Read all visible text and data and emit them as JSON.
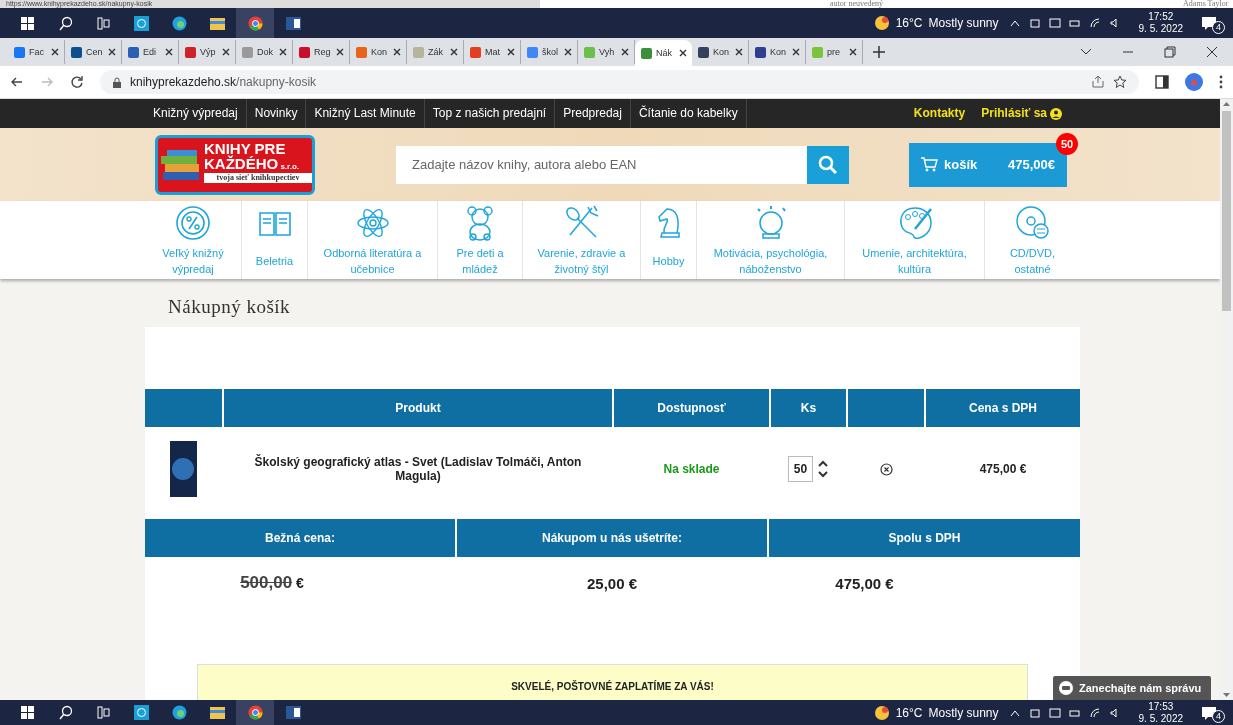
{
  "background_strip": {
    "url": "https://www.knihyprekazdeho.sk/nakupny-kosik",
    "texts": [
      "autor neuvedený",
      "Adams Taylor"
    ]
  },
  "taskbar_top": {
    "temperature": "16°C",
    "weather": "Mostly sunny",
    "time": "17:52",
    "date": "9. 5. 2022",
    "notifications": "4"
  },
  "tabs": [
    {
      "label": "Fac",
      "selected": false,
      "color": "#1877f2"
    },
    {
      "label": "Cen",
      "selected": false,
      "color": "#0b4f8c"
    },
    {
      "label": "Edi",
      "selected": false,
      "color": "#2b5fb4"
    },
    {
      "label": "Výp",
      "selected": false,
      "color": "#d0202a"
    },
    {
      "label": "Dok",
      "selected": false,
      "color": "#9a9a9a"
    },
    {
      "label": "Reg",
      "selected": false,
      "color": "#c8102e"
    },
    {
      "label": "Kon",
      "selected": false,
      "color": "#e8641b"
    },
    {
      "label": "Zák",
      "selected": false,
      "color": "#b8b49a"
    },
    {
      "label": "Mat",
      "selected": false,
      "color": "#e04020"
    },
    {
      "label": "škol",
      "selected": false,
      "color": "#4285f4"
    },
    {
      "label": "Vyh",
      "selected": false,
      "color": "#6cc04a"
    },
    {
      "label": "Nák",
      "selected": true,
      "color": "#3a8f3a"
    },
    {
      "label": "Kon",
      "selected": false,
      "color": "#33415c"
    },
    {
      "label": "Kon",
      "selected": false,
      "color": "#2f3f8f"
    },
    {
      "label": "pre",
      "selected": false,
      "color": "#7cc43a"
    }
  ],
  "address_bar": {
    "domain": "knihyprekazdeho.sk",
    "path": "/nakupny-kosik"
  },
  "top_nav": {
    "links": [
      "Knižný výpredaj",
      "Novinky",
      "Knižný Last Minute",
      "Top z našich predajní",
      "Predpredaj",
      "Čítanie do kabelky"
    ],
    "contact": "Kontakty",
    "login": "Prihlásiť sa"
  },
  "header": {
    "logo": {
      "line1": "KNIHY PRE",
      "line2": "KAŽDÉHO",
      "suffix": "s.r.o.",
      "tagline": "tvoja sieť knihkupectiev"
    },
    "search": {
      "placeholder": "Zadajte názov knihy, autora alebo EAN"
    },
    "cart": {
      "label": "košík",
      "total": "475,00€",
      "count": "50"
    }
  },
  "categories": [
    {
      "kind": "percent",
      "label": "Veľký knižný výpredaj"
    },
    {
      "kind": "book",
      "label": "Beletria"
    },
    {
      "kind": "atom",
      "label": "Odborná literatúra a učebnice"
    },
    {
      "kind": "teddy",
      "label": "Pre deti a mládež"
    },
    {
      "kind": "cutlery",
      "label": "Varenie, zdravie a životný štýl"
    },
    {
      "kind": "knight",
      "label": "Hobby"
    },
    {
      "kind": "crystal",
      "label": "Motivácia, psychológia, náboženstvo"
    },
    {
      "kind": "palette",
      "label": "Umenie, architektúra, kultúra"
    },
    {
      "kind": "disc",
      "label": "CD/DVD, ostatné"
    }
  ],
  "page_title": "Nákupný košík",
  "cart_table": {
    "columns": [
      "Produkt",
      "Dostupnosť",
      "Ks",
      "Cena s DPH"
    ],
    "rows": [
      {
        "title": "Školský geografický atlas - Svet (Ladislav Tolmáči, Anton Magula)",
        "availability": "Na sklade",
        "quantity": "50",
        "price": "475,00 €"
      }
    ]
  },
  "summary": {
    "columns": [
      "Bežná cena:",
      "Nákupom u nás ušetríte:",
      "Spolu s DPH"
    ],
    "regular_price": "500,00",
    "currency": "€",
    "savings": "25,00 €",
    "total": "475,00 €"
  },
  "shipping_notice": "SKVELÉ, POŠTOVNÉ ZAPLATÍME ZA VÁS!",
  "chat_button": "Zanechajte nám správu",
  "taskbar_bottom": {
    "temperature": "16°C",
    "weather": "Mostly sunny",
    "time": "17:53",
    "date": "9. 5. 2022",
    "notifications": "4"
  }
}
